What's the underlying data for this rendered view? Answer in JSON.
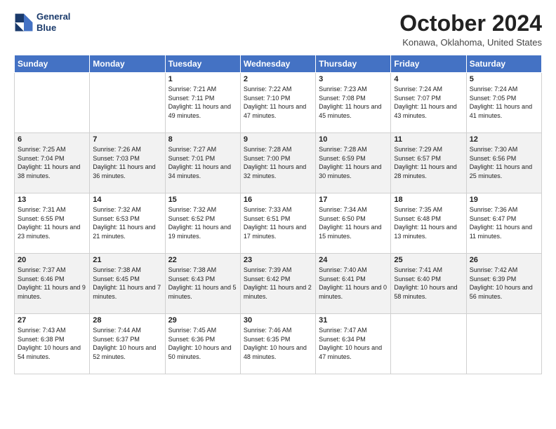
{
  "header": {
    "logo": {
      "line1": "General",
      "line2": "Blue"
    },
    "title": "October 2024",
    "location": "Konawa, Oklahoma, United States"
  },
  "days_of_week": [
    "Sunday",
    "Monday",
    "Tuesday",
    "Wednesday",
    "Thursday",
    "Friday",
    "Saturday"
  ],
  "weeks": [
    [
      {
        "day": "",
        "info": ""
      },
      {
        "day": "",
        "info": ""
      },
      {
        "day": "1",
        "info": "Sunrise: 7:21 AM\nSunset: 7:11 PM\nDaylight: 11 hours and 49 minutes."
      },
      {
        "day": "2",
        "info": "Sunrise: 7:22 AM\nSunset: 7:10 PM\nDaylight: 11 hours and 47 minutes."
      },
      {
        "day": "3",
        "info": "Sunrise: 7:23 AM\nSunset: 7:08 PM\nDaylight: 11 hours and 45 minutes."
      },
      {
        "day": "4",
        "info": "Sunrise: 7:24 AM\nSunset: 7:07 PM\nDaylight: 11 hours and 43 minutes."
      },
      {
        "day": "5",
        "info": "Sunrise: 7:24 AM\nSunset: 7:05 PM\nDaylight: 11 hours and 41 minutes."
      }
    ],
    [
      {
        "day": "6",
        "info": "Sunrise: 7:25 AM\nSunset: 7:04 PM\nDaylight: 11 hours and 38 minutes."
      },
      {
        "day": "7",
        "info": "Sunrise: 7:26 AM\nSunset: 7:03 PM\nDaylight: 11 hours and 36 minutes."
      },
      {
        "day": "8",
        "info": "Sunrise: 7:27 AM\nSunset: 7:01 PM\nDaylight: 11 hours and 34 minutes."
      },
      {
        "day": "9",
        "info": "Sunrise: 7:28 AM\nSunset: 7:00 PM\nDaylight: 11 hours and 32 minutes."
      },
      {
        "day": "10",
        "info": "Sunrise: 7:28 AM\nSunset: 6:59 PM\nDaylight: 11 hours and 30 minutes."
      },
      {
        "day": "11",
        "info": "Sunrise: 7:29 AM\nSunset: 6:57 PM\nDaylight: 11 hours and 28 minutes."
      },
      {
        "day": "12",
        "info": "Sunrise: 7:30 AM\nSunset: 6:56 PM\nDaylight: 11 hours and 25 minutes."
      }
    ],
    [
      {
        "day": "13",
        "info": "Sunrise: 7:31 AM\nSunset: 6:55 PM\nDaylight: 11 hours and 23 minutes."
      },
      {
        "day": "14",
        "info": "Sunrise: 7:32 AM\nSunset: 6:53 PM\nDaylight: 11 hours and 21 minutes."
      },
      {
        "day": "15",
        "info": "Sunrise: 7:32 AM\nSunset: 6:52 PM\nDaylight: 11 hours and 19 minutes."
      },
      {
        "day": "16",
        "info": "Sunrise: 7:33 AM\nSunset: 6:51 PM\nDaylight: 11 hours and 17 minutes."
      },
      {
        "day": "17",
        "info": "Sunrise: 7:34 AM\nSunset: 6:50 PM\nDaylight: 11 hours and 15 minutes."
      },
      {
        "day": "18",
        "info": "Sunrise: 7:35 AM\nSunset: 6:48 PM\nDaylight: 11 hours and 13 minutes."
      },
      {
        "day": "19",
        "info": "Sunrise: 7:36 AM\nSunset: 6:47 PM\nDaylight: 11 hours and 11 minutes."
      }
    ],
    [
      {
        "day": "20",
        "info": "Sunrise: 7:37 AM\nSunset: 6:46 PM\nDaylight: 11 hours and 9 minutes."
      },
      {
        "day": "21",
        "info": "Sunrise: 7:38 AM\nSunset: 6:45 PM\nDaylight: 11 hours and 7 minutes."
      },
      {
        "day": "22",
        "info": "Sunrise: 7:38 AM\nSunset: 6:43 PM\nDaylight: 11 hours and 5 minutes."
      },
      {
        "day": "23",
        "info": "Sunrise: 7:39 AM\nSunset: 6:42 PM\nDaylight: 11 hours and 2 minutes."
      },
      {
        "day": "24",
        "info": "Sunrise: 7:40 AM\nSunset: 6:41 PM\nDaylight: 11 hours and 0 minutes."
      },
      {
        "day": "25",
        "info": "Sunrise: 7:41 AM\nSunset: 6:40 PM\nDaylight: 10 hours and 58 minutes."
      },
      {
        "day": "26",
        "info": "Sunrise: 7:42 AM\nSunset: 6:39 PM\nDaylight: 10 hours and 56 minutes."
      }
    ],
    [
      {
        "day": "27",
        "info": "Sunrise: 7:43 AM\nSunset: 6:38 PM\nDaylight: 10 hours and 54 minutes."
      },
      {
        "day": "28",
        "info": "Sunrise: 7:44 AM\nSunset: 6:37 PM\nDaylight: 10 hours and 52 minutes."
      },
      {
        "day": "29",
        "info": "Sunrise: 7:45 AM\nSunset: 6:36 PM\nDaylight: 10 hours and 50 minutes."
      },
      {
        "day": "30",
        "info": "Sunrise: 7:46 AM\nSunset: 6:35 PM\nDaylight: 10 hours and 48 minutes."
      },
      {
        "day": "31",
        "info": "Sunrise: 7:47 AM\nSunset: 6:34 PM\nDaylight: 10 hours and 47 minutes."
      },
      {
        "day": "",
        "info": ""
      },
      {
        "day": "",
        "info": ""
      }
    ]
  ]
}
